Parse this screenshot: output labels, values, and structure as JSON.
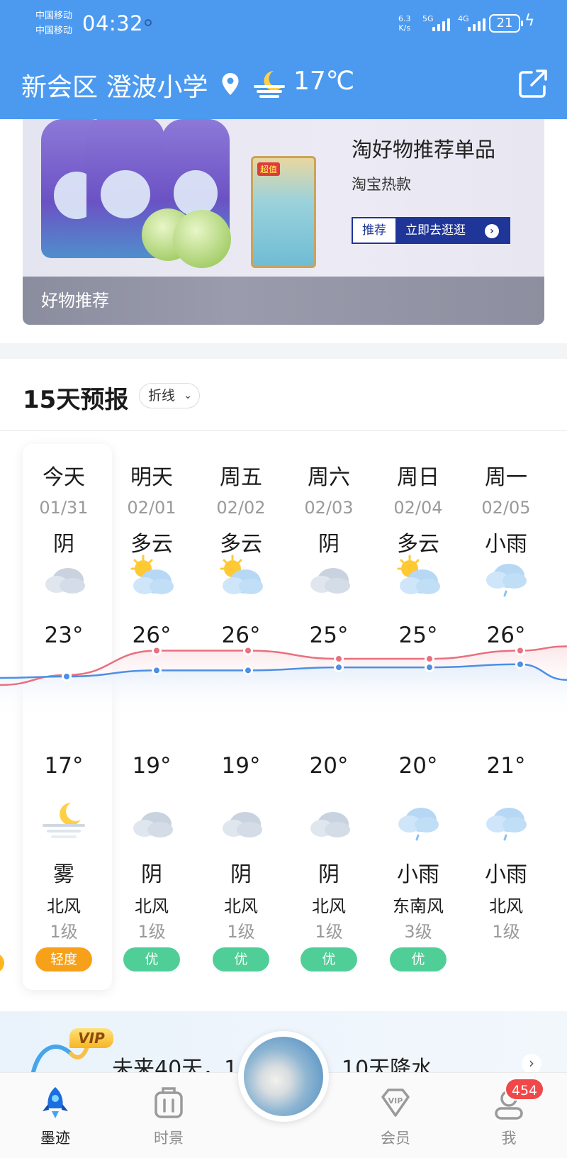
{
  "status_bar": {
    "carrier1": "中国移动",
    "carrier2": "中国移动",
    "time": "04:32",
    "speed_value": "6.3",
    "speed_unit": "K/s",
    "net1": "5G",
    "net2": "4G",
    "battery": "21"
  },
  "location_bar": {
    "location": "新会区 澄波小学",
    "current_temp": "17℃",
    "weather_icon": "moon-haze-icon",
    "share_icon": "share-icon",
    "pin_icon": "location-pin-icon"
  },
  "ad": {
    "title": "淘好物推荐单品",
    "subtitle": "淘宝热款",
    "tag": "推荐",
    "cta": "立即去逛逛",
    "footer": "好物推荐",
    "pouch_label": "超值"
  },
  "forecast": {
    "title": "15天预报",
    "mode": "折线",
    "days": [
      {
        "name": "今天",
        "date": "01/31",
        "day_weather": "阴",
        "day_icon": "cloudy",
        "high": "23°",
        "low": "17°",
        "night_icon": "moon-haze",
        "night_weather": "雾",
        "wind": "北风",
        "wind_level": "1级",
        "aqi": "轻度",
        "aqi_color": "#f7a11a"
      },
      {
        "name": "明天",
        "date": "02/01",
        "day_weather": "多云",
        "day_icon": "partly-cloudy",
        "high": "26°",
        "low": "19°",
        "night_icon": "cloudy",
        "night_weather": "阴",
        "wind": "北风",
        "wind_level": "1级",
        "aqi": "优",
        "aqi_color": "#4fcf97"
      },
      {
        "name": "周五",
        "date": "02/02",
        "day_weather": "多云",
        "day_icon": "partly-cloudy",
        "high": "26°",
        "low": "19°",
        "night_icon": "cloudy",
        "night_weather": "阴",
        "wind": "北风",
        "wind_level": "1级",
        "aqi": "优",
        "aqi_color": "#4fcf97"
      },
      {
        "name": "周六",
        "date": "02/03",
        "day_weather": "阴",
        "day_icon": "cloudy",
        "high": "25°",
        "low": "20°",
        "night_icon": "cloudy",
        "night_weather": "阴",
        "wind": "北风",
        "wind_level": "1级",
        "aqi": "优",
        "aqi_color": "#4fcf97"
      },
      {
        "name": "周日",
        "date": "02/04",
        "day_weather": "多云",
        "day_icon": "partly-cloudy",
        "high": "25°",
        "low": "20°",
        "night_icon": "light-rain",
        "night_weather": "小雨",
        "wind": "东南风",
        "wind_level": "3级",
        "aqi": "优",
        "aqi_color": "#4fcf97"
      },
      {
        "name": "周一",
        "date": "02/05",
        "day_weather": "小雨",
        "day_icon": "light-rain",
        "high": "26°",
        "low": "21°",
        "night_icon": "light-rain",
        "night_weather": "小雨",
        "wind": "北风",
        "wind_level": "1级",
        "aqi": "",
        "aqi_color": ""
      }
    ],
    "high_line_color": "#e9707f",
    "low_line_color": "#4d8fe6"
  },
  "chart_data": {
    "type": "line",
    "categories": [
      "01/31",
      "02/01",
      "02/02",
      "02/03",
      "02/04",
      "02/05"
    ],
    "series": [
      {
        "values": [
          23,
          26,
          26,
          25,
          25,
          26
        ]
      },
      {
        "values": [
          17,
          19,
          19,
          20,
          20,
          21
        ]
      }
    ]
  },
  "vip": {
    "badge": "VIP",
    "text_left": "未来40天，1",
    "text_right": "10天降水",
    "arrow": "›"
  },
  "tabbar": {
    "tabs": [
      {
        "label": "墨迹",
        "icon": "rocket-icon",
        "active": true
      },
      {
        "label": "时景",
        "icon": "camera-icon",
        "active": false
      },
      {
        "label": "会员",
        "icon": "vip-gem-icon",
        "active": false
      },
      {
        "label": "我",
        "icon": "profile-icon",
        "active": false
      }
    ],
    "badge": "454"
  },
  "colors": {
    "header_blue": "#4c9af0",
    "active_tab": "#1b6ee0",
    "aqi_good": "#4fcf97",
    "aqi_light": "#f7a11a"
  }
}
